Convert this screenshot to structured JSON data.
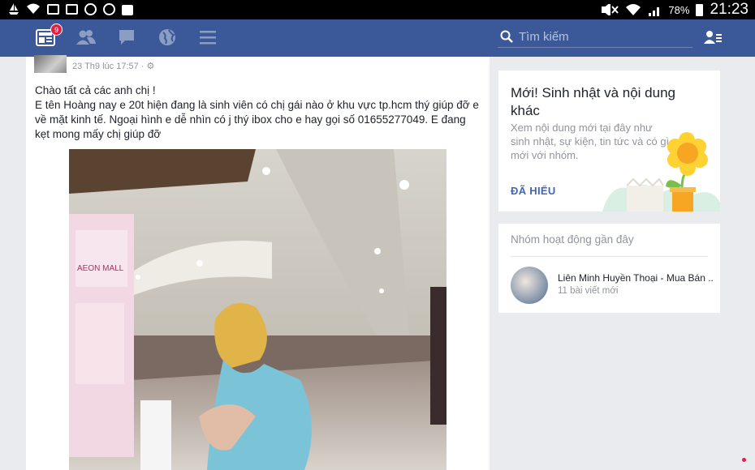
{
  "status_bar": {
    "battery": "78%",
    "time": "21:23"
  },
  "top_bar": {
    "notification_count": "9",
    "search_placeholder": "Tìm kiếm"
  },
  "post": {
    "timestamp": "23 Th9 lúc 17:57 · ⚙",
    "lines": [
      "Chào tất cả các anh chị !",
      "E tên Hoàng nay e 20t hiện đang là sinh viên có chị gái nào ở khu vực tp.hcm thý giúp đỡ e về mặt kinh tế. Ngoại hình e dễ nhìn có j thý ibox cho e hay gọi số 01655277049. E đang kẹt mong mấy chị giúp đỡ"
    ],
    "sign_text": "AEON MALL"
  },
  "birthday_card": {
    "title": "Mới! Sinh nhật và nội dung khác",
    "description": "Xem nội dung mới tại đây như sinh nhật, sự kiện, tin tức và có gì mới với nhóm.",
    "action": "ĐÃ HIỂU"
  },
  "groups_card": {
    "header": "Nhóm hoạt động gần đây",
    "items": [
      {
        "name": "Liên Minh Huyền Thoại - Mua Bán ...",
        "subtitle": "11 bài viết mới"
      }
    ]
  },
  "colors": {
    "facebook_blue": "#3b5998",
    "link_blue": "#4267b2",
    "background": "#e9ebee"
  }
}
